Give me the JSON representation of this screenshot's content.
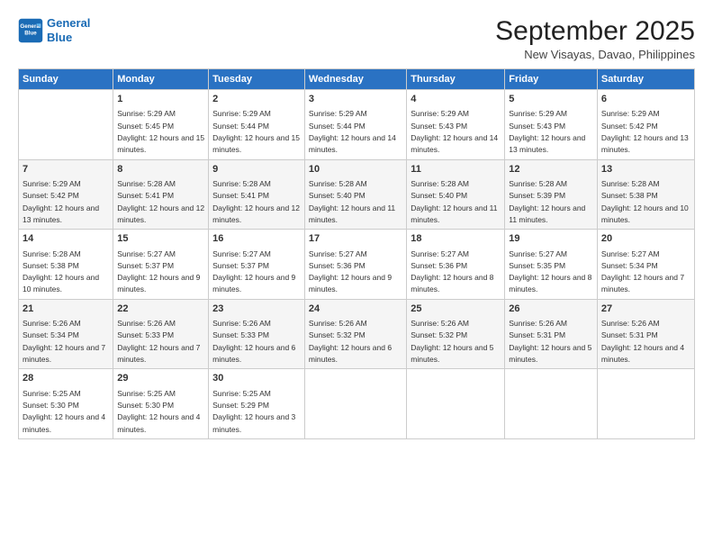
{
  "logo": {
    "line1": "General",
    "line2": "Blue"
  },
  "title": "September 2025",
  "subtitle": "New Visayas, Davao, Philippines",
  "days": [
    "Sunday",
    "Monday",
    "Tuesday",
    "Wednesday",
    "Thursday",
    "Friday",
    "Saturday"
  ],
  "weeks": [
    [
      {
        "day": "",
        "sunrise": "",
        "sunset": "",
        "daylight": ""
      },
      {
        "day": "1",
        "sunrise": "5:29 AM",
        "sunset": "5:45 PM",
        "daylight": "12 hours and 15 minutes."
      },
      {
        "day": "2",
        "sunrise": "5:29 AM",
        "sunset": "5:44 PM",
        "daylight": "12 hours and 15 minutes."
      },
      {
        "day": "3",
        "sunrise": "5:29 AM",
        "sunset": "5:44 PM",
        "daylight": "12 hours and 14 minutes."
      },
      {
        "day": "4",
        "sunrise": "5:29 AM",
        "sunset": "5:43 PM",
        "daylight": "12 hours and 14 minutes."
      },
      {
        "day": "5",
        "sunrise": "5:29 AM",
        "sunset": "5:43 PM",
        "daylight": "12 hours and 13 minutes."
      },
      {
        "day": "6",
        "sunrise": "5:29 AM",
        "sunset": "5:42 PM",
        "daylight": "12 hours and 13 minutes."
      }
    ],
    [
      {
        "day": "7",
        "sunrise": "5:29 AM",
        "sunset": "5:42 PM",
        "daylight": "12 hours and 13 minutes."
      },
      {
        "day": "8",
        "sunrise": "5:28 AM",
        "sunset": "5:41 PM",
        "daylight": "12 hours and 12 minutes."
      },
      {
        "day": "9",
        "sunrise": "5:28 AM",
        "sunset": "5:41 PM",
        "daylight": "12 hours and 12 minutes."
      },
      {
        "day": "10",
        "sunrise": "5:28 AM",
        "sunset": "5:40 PM",
        "daylight": "12 hours and 11 minutes."
      },
      {
        "day": "11",
        "sunrise": "5:28 AM",
        "sunset": "5:40 PM",
        "daylight": "12 hours and 11 minutes."
      },
      {
        "day": "12",
        "sunrise": "5:28 AM",
        "sunset": "5:39 PM",
        "daylight": "12 hours and 11 minutes."
      },
      {
        "day": "13",
        "sunrise": "5:28 AM",
        "sunset": "5:38 PM",
        "daylight": "12 hours and 10 minutes."
      }
    ],
    [
      {
        "day": "14",
        "sunrise": "5:28 AM",
        "sunset": "5:38 PM",
        "daylight": "12 hours and 10 minutes."
      },
      {
        "day": "15",
        "sunrise": "5:27 AM",
        "sunset": "5:37 PM",
        "daylight": "12 hours and 9 minutes."
      },
      {
        "day": "16",
        "sunrise": "5:27 AM",
        "sunset": "5:37 PM",
        "daylight": "12 hours and 9 minutes."
      },
      {
        "day": "17",
        "sunrise": "5:27 AM",
        "sunset": "5:36 PM",
        "daylight": "12 hours and 9 minutes."
      },
      {
        "day": "18",
        "sunrise": "5:27 AM",
        "sunset": "5:36 PM",
        "daylight": "12 hours and 8 minutes."
      },
      {
        "day": "19",
        "sunrise": "5:27 AM",
        "sunset": "5:35 PM",
        "daylight": "12 hours and 8 minutes."
      },
      {
        "day": "20",
        "sunrise": "5:27 AM",
        "sunset": "5:34 PM",
        "daylight": "12 hours and 7 minutes."
      }
    ],
    [
      {
        "day": "21",
        "sunrise": "5:26 AM",
        "sunset": "5:34 PM",
        "daylight": "12 hours and 7 minutes."
      },
      {
        "day": "22",
        "sunrise": "5:26 AM",
        "sunset": "5:33 PM",
        "daylight": "12 hours and 7 minutes."
      },
      {
        "day": "23",
        "sunrise": "5:26 AM",
        "sunset": "5:33 PM",
        "daylight": "12 hours and 6 minutes."
      },
      {
        "day": "24",
        "sunrise": "5:26 AM",
        "sunset": "5:32 PM",
        "daylight": "12 hours and 6 minutes."
      },
      {
        "day": "25",
        "sunrise": "5:26 AM",
        "sunset": "5:32 PM",
        "daylight": "12 hours and 5 minutes."
      },
      {
        "day": "26",
        "sunrise": "5:26 AM",
        "sunset": "5:31 PM",
        "daylight": "12 hours and 5 minutes."
      },
      {
        "day": "27",
        "sunrise": "5:26 AM",
        "sunset": "5:31 PM",
        "daylight": "12 hours and 4 minutes."
      }
    ],
    [
      {
        "day": "28",
        "sunrise": "5:25 AM",
        "sunset": "5:30 PM",
        "daylight": "12 hours and 4 minutes."
      },
      {
        "day": "29",
        "sunrise": "5:25 AM",
        "sunset": "5:30 PM",
        "daylight": "12 hours and 4 minutes."
      },
      {
        "day": "30",
        "sunrise": "5:25 AM",
        "sunset": "5:29 PM",
        "daylight": "12 hours and 3 minutes."
      },
      {
        "day": "",
        "sunrise": "",
        "sunset": "",
        "daylight": ""
      },
      {
        "day": "",
        "sunrise": "",
        "sunset": "",
        "daylight": ""
      },
      {
        "day": "",
        "sunrise": "",
        "sunset": "",
        "daylight": ""
      },
      {
        "day": "",
        "sunrise": "",
        "sunset": "",
        "daylight": ""
      }
    ]
  ]
}
